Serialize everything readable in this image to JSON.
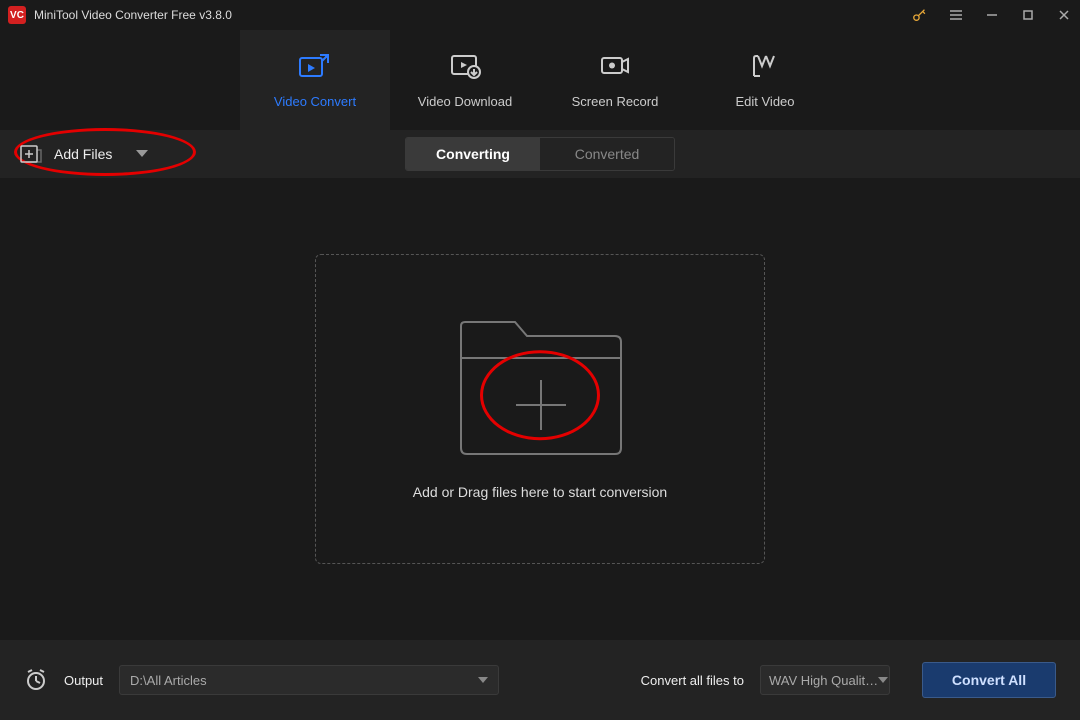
{
  "titlebar": {
    "app_title": "MiniTool Video Converter Free v3.8.0"
  },
  "nav": {
    "video_convert": "Video Convert",
    "video_download": "Video Download",
    "screen_record": "Screen Record",
    "edit_video": "Edit Video"
  },
  "toolbar": {
    "add_files_label": "Add Files"
  },
  "subtabs": {
    "converting": "Converting",
    "converted": "Converted"
  },
  "dropzone": {
    "text": "Add or Drag files here to start conversion"
  },
  "footer": {
    "output_label": "Output",
    "output_path": "D:\\All Articles",
    "convert_all_label": "Convert all files to",
    "format_value": "WAV High Qualit…",
    "convert_all_btn": "Convert All"
  },
  "colors": {
    "accent_blue": "#2d7bff",
    "annotation_red": "#e40000"
  }
}
